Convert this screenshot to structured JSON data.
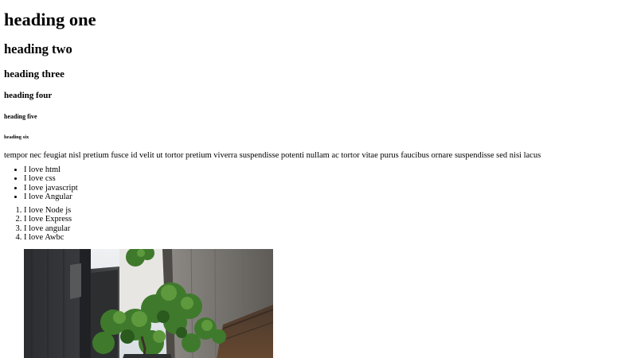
{
  "headings": {
    "h1": "heading one",
    "h2": "heading two",
    "h3": "heading three",
    "h4": "heading four",
    "h5": "heading five",
    "h6": "heading six"
  },
  "paragraph": "tempor nec feugiat nisl pretium fusce id velit ut tortor pretium viverra suspendisse potenti nullam ac tortor vitae purus faucibus ornare suspendisse sed nisi lacus",
  "unordered_list": [
    "I love html",
    "I love css",
    "I love javascript",
    "I love Angular"
  ],
  "ordered_list": [
    "I love Node js",
    "I love Express",
    "I love angular",
    "I love Awbc"
  ],
  "image": {
    "subject": "alley-between-buildings-with-tree"
  },
  "colors": {
    "text": "#000000",
    "background": "#ffffff"
  }
}
